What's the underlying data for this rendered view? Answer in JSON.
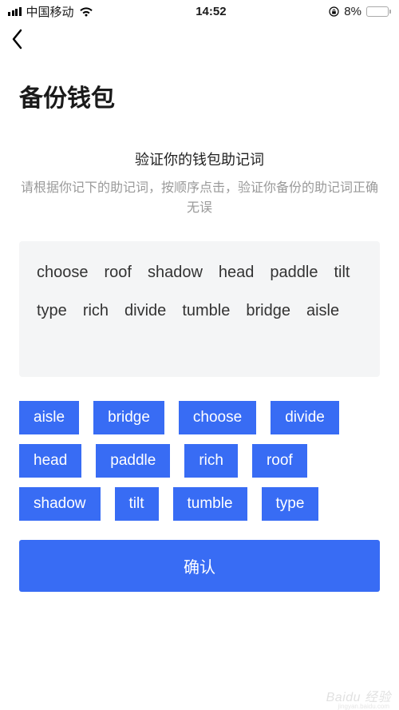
{
  "status": {
    "carrier": "中国移动",
    "time": "14:52",
    "battery_pct": "8%"
  },
  "page": {
    "title": "备份钱包",
    "section_title": "验证你的钱包助记词",
    "section_desc": "请根据你记下的助记词，按顺序点击，验证你备份的助记词正确无误"
  },
  "phrase": {
    "words": [
      "choose",
      "roof",
      "shadow",
      "head",
      "paddle",
      "tilt",
      "type",
      "rich",
      "divide",
      "tumble",
      "bridge",
      "aisle"
    ]
  },
  "chips": [
    "aisle",
    "bridge",
    "choose",
    "divide",
    "head",
    "paddle",
    "rich",
    "roof",
    "shadow",
    "tilt",
    "tumble",
    "type"
  ],
  "confirm_label": "确认",
  "watermark": {
    "brand": "Baidu 经验",
    "sub": "jingyan.baidu.com"
  },
  "chart_data": {
    "type": "table",
    "note": "no chart in image"
  }
}
